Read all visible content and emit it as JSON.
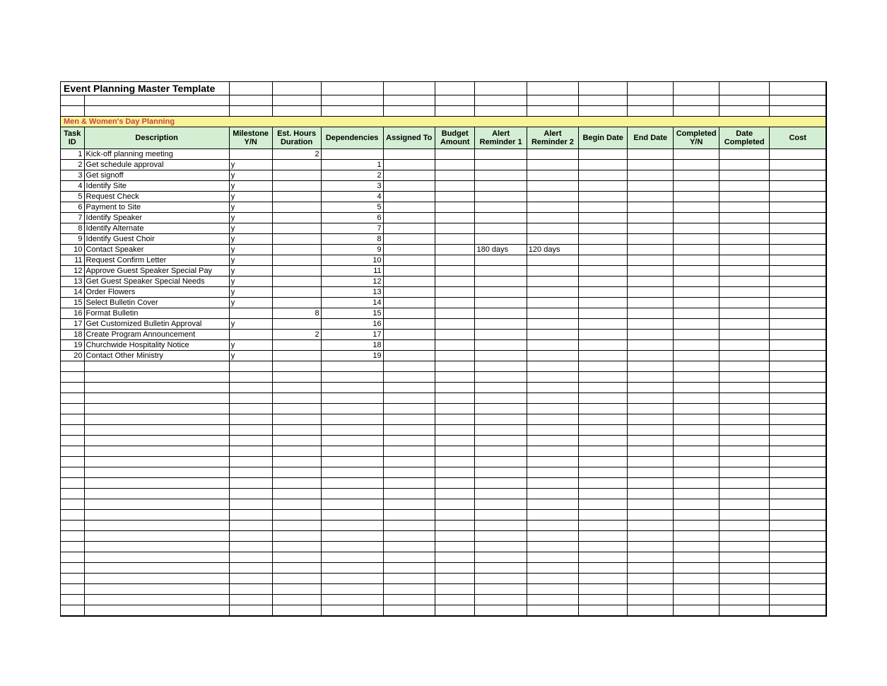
{
  "title": "Event Planning  Master Template",
  "section": "Men & Women's Day Planning",
  "columns": {
    "task_id": "Task ID",
    "description": "Description",
    "milestone": "Milestone Y/N",
    "est_hours": "Est. Hours Duration",
    "dependencies": "Dependencies",
    "assigned_to": "Assigned To",
    "budget": "Budget Amount",
    "alert1": "Alert Reminder 1",
    "alert2": "Alert Reminder 2",
    "begin": "Begin Date",
    "end": "End  Date",
    "completed_yn": "Completed Y/N",
    "date_completed": "Date Completed",
    "cost": "Cost"
  },
  "rows": [
    {
      "id": "1",
      "desc": "Kick-off planning meeting",
      "ms": "",
      "est": "2",
      "dep": "",
      "ar1": "",
      "ar2": ""
    },
    {
      "id": "2",
      "desc": "Get schedule approval",
      "ms": "y",
      "est": "",
      "dep": "1",
      "ar1": "",
      "ar2": ""
    },
    {
      "id": "3",
      "desc": "Get signoff",
      "ms": "y",
      "est": "",
      "dep": "2",
      "ar1": "",
      "ar2": ""
    },
    {
      "id": "4",
      "desc": "Identify Site",
      "ms": "y",
      "est": "",
      "dep": "3",
      "ar1": "",
      "ar2": ""
    },
    {
      "id": "5",
      "desc": "Request Check",
      "ms": "y",
      "est": "",
      "dep": "4",
      "ar1": "",
      "ar2": ""
    },
    {
      "id": "6",
      "desc": "Payment to Site",
      "ms": "y",
      "est": "",
      "dep": "5",
      "ar1": "",
      "ar2": ""
    },
    {
      "id": "7",
      "desc": "Identify Speaker",
      "ms": "y",
      "est": "",
      "dep": "6",
      "ar1": "",
      "ar2": ""
    },
    {
      "id": "8",
      "desc": "Identify Alternate",
      "ms": "y",
      "est": "",
      "dep": "7",
      "ar1": "",
      "ar2": ""
    },
    {
      "id": "9",
      "desc": "Identify Guest Choir",
      "ms": "y",
      "est": "",
      "dep": "8",
      "ar1": "",
      "ar2": ""
    },
    {
      "id": "10",
      "desc": "Contact Speaker",
      "ms": "y",
      "est": "",
      "dep": "9",
      "ar1": "180 days",
      "ar2": "120 days"
    },
    {
      "id": "11",
      "desc": "Request Confirm Letter",
      "ms": "y",
      "est": "",
      "dep": "10",
      "ar1": "",
      "ar2": ""
    },
    {
      "id": "12",
      "desc": "Approve Guest Speaker Special Pay",
      "ms": "y",
      "est": "",
      "dep": "11",
      "ar1": "",
      "ar2": ""
    },
    {
      "id": "13",
      "desc": "Get Guest Speaker Special Needs",
      "ms": "y",
      "est": "",
      "dep": "12",
      "ar1": "",
      "ar2": ""
    },
    {
      "id": "14",
      "desc": "Order Flowers",
      "ms": "y",
      "est": "",
      "dep": "13",
      "ar1": "",
      "ar2": ""
    },
    {
      "id": "15",
      "desc": "Select Bulletin Cover",
      "ms": "y",
      "est": "",
      "dep": "14",
      "ar1": "",
      "ar2": ""
    },
    {
      "id": "16",
      "desc": "Format Bulletin",
      "ms": "",
      "est": "8",
      "dep": "15",
      "ar1": "",
      "ar2": ""
    },
    {
      "id": "17",
      "desc": "Get Customized Bulletin Approval",
      "ms": "y",
      "est": "",
      "dep": "16",
      "ar1": "",
      "ar2": ""
    },
    {
      "id": "18",
      "desc": "Create Program Announcement",
      "ms": "",
      "est": "2",
      "dep": "17",
      "ar1": "",
      "ar2": ""
    },
    {
      "id": "19",
      "desc": "Churchwide Hospitality Notice",
      "ms": "y",
      "est": "",
      "dep": "18",
      "ar1": "",
      "ar2": ""
    },
    {
      "id": "20",
      "desc": "Contact Other Ministry",
      "ms": "y",
      "est": "",
      "dep": "19",
      "ar1": "",
      "ar2": ""
    }
  ],
  "empty_rows": 24
}
